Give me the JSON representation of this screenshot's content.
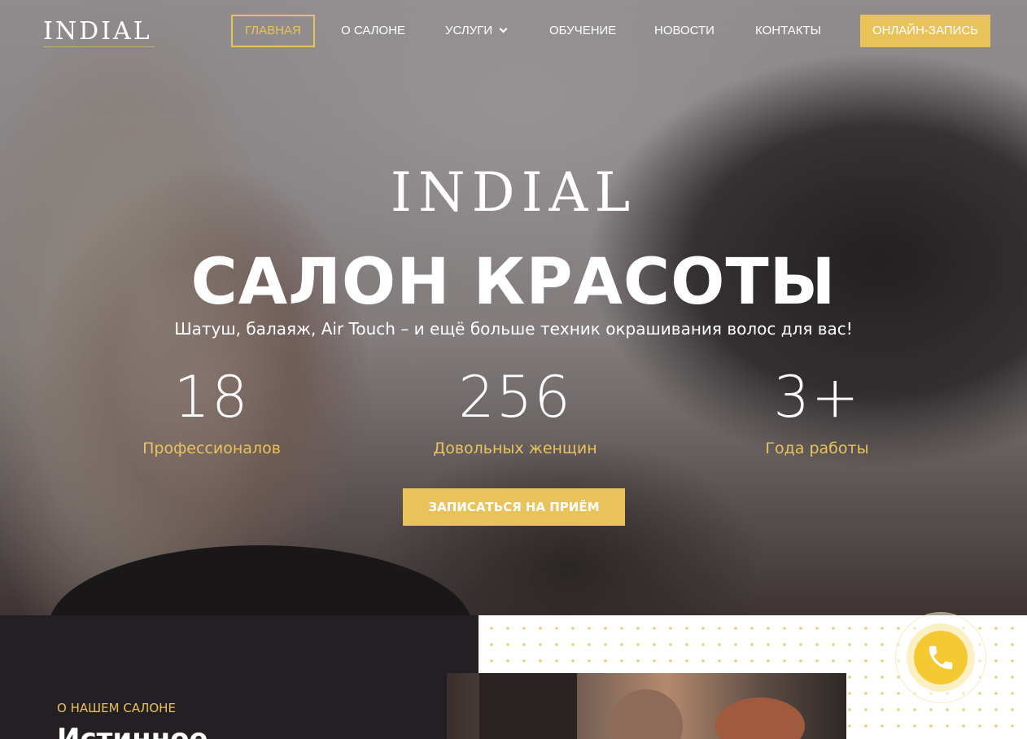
{
  "header": {
    "logo_text": "INDIAL",
    "nav": [
      {
        "label": "Главная",
        "active": true
      },
      {
        "label": "О салоне"
      },
      {
        "label": "Услуги",
        "has_dropdown": true
      },
      {
        "label": "Обучение"
      },
      {
        "label": "Новости"
      },
      {
        "label": "Контакты"
      }
    ],
    "cta_label": "Онлайн-запись"
  },
  "hero": {
    "logo_text": "INDIAL",
    "title": "САЛОН КРАСОТЫ",
    "subtitle": "Шатуш, балаяж, Air Touch – и ещё больше техник окрашивания волос для вас!",
    "stats": [
      {
        "value": "18",
        "label": "Профессионалов"
      },
      {
        "value": "256",
        "label": "Довольных женщин"
      },
      {
        "value": "3+",
        "label": "Года работы"
      }
    ],
    "button_label": "Записаться на приём"
  },
  "about": {
    "eyebrow": "О нашем салоне",
    "heading": "Истинное"
  },
  "call_widget": {
    "icon": "phone-icon"
  },
  "colors": {
    "accent": "#e9c35a",
    "dark_bg": "#231f23",
    "call_button": "#f4c932",
    "text_light": "#ffffff"
  }
}
